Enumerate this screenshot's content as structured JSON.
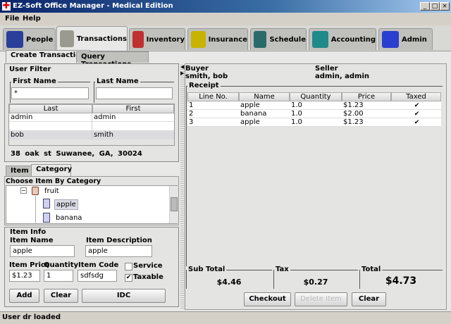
{
  "window": {
    "title": "EZ-Soft Office Manager  -  Medical Edition",
    "min": "_",
    "max": "□",
    "close": "×"
  },
  "menu": [
    "File",
    "Help"
  ],
  "tabs": [
    {
      "label": "People",
      "color": "#2a3f9a"
    },
    {
      "label": "Transactions",
      "color": "#9a9a90"
    },
    {
      "label": "Inventory",
      "color": "#c03030"
    },
    {
      "label": "Insurance",
      "color": "#c8b400"
    },
    {
      "label": "Schedule",
      "color": "#2a6a6a"
    },
    {
      "label": "Accounting",
      "color": "#1f8a8a"
    },
    {
      "label": "Admin",
      "color": "#2a3fcf"
    }
  ],
  "subtabs": [
    "Create Transaction",
    "Query Transactions"
  ],
  "user_filter": {
    "title": "User Filter",
    "first_label": "First Name",
    "first_value": "*",
    "last_label": "Last Name",
    "last_value": "",
    "columns": [
      "Last",
      "First"
    ],
    "rows": [
      [
        "admin",
        "admin"
      ],
      [
        "",
        ""
      ],
      [
        "bob",
        "smith"
      ]
    ],
    "address": "38 oak st   Suwanee, GA, 30024"
  },
  "item_tabs": [
    "Item",
    "Category"
  ],
  "category": {
    "title": "Choose Item By Category",
    "tree": {
      "root": "fruit",
      "expander": "−",
      "children": [
        "apple",
        "banana"
      ]
    }
  },
  "item_info": {
    "title": "Item Info",
    "name_label": "Item Name",
    "name_value": "apple",
    "desc_label": "Item Description",
    "desc_value": "apple",
    "price_label": "Item Price",
    "price_value": "$1.23",
    "qty_label": "Quantity",
    "qty_value": "1",
    "code_label": "Item Code",
    "code_value": "sdfsdg",
    "service_label": "Service",
    "service_checked": false,
    "taxable_label": "Taxable",
    "taxable_checked": true,
    "add": "Add",
    "clear": "Clear",
    "idc": "IDC"
  },
  "transaction": {
    "buyer_label": "Buyer",
    "buyer": "smith, bob",
    "seller_label": "Seller",
    "seller": "admin, admin",
    "receipt_title": "Receipt",
    "columns": [
      "Line No.",
      "Name",
      "Quantity",
      "Price",
      "Taxed"
    ],
    "rows": [
      [
        "1",
        "apple",
        "1.0",
        "$1.23",
        "✔"
      ],
      [
        "2",
        "banana",
        "1.0",
        "$2.00",
        "✔"
      ],
      [
        "3",
        "apple",
        "1.0",
        "$1.23",
        "✔"
      ]
    ],
    "subtotal_label": "Sub Total",
    "subtotal": "$4.46",
    "tax_label": "Tax",
    "tax": "$0.27",
    "total_label": "Total",
    "total": "$4.73",
    "checkout": "Checkout",
    "delete": "Delete Item",
    "clear": "Clear"
  },
  "status": "User dr loaded"
}
